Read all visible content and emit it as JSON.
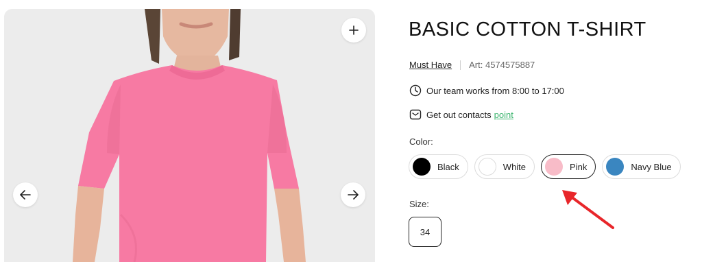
{
  "gallery": {
    "image_desc": "woman-wearing-pink-tshirt",
    "zoom_icon": "plus-icon",
    "prev_icon": "arrow-left-icon",
    "next_icon": "arrow-right-icon"
  },
  "product": {
    "title": "BASIC COTTON T-SHIRT",
    "brand": "Must Have",
    "article": "Art: 4574575887"
  },
  "info": {
    "hours": "Our team works from 8:00 to 17:00",
    "contacts_text": "Get out contacts",
    "contacts_link": "point",
    "hours_icon": "clock-icon",
    "contacts_icon": "message-icon"
  },
  "color": {
    "label": "Color:",
    "options": [
      {
        "name": "Black",
        "hex": "#000000",
        "selected": false
      },
      {
        "name": "White",
        "hex": "#ffffff",
        "selected": false
      },
      {
        "name": "Pink",
        "hex": "#f8bcc8",
        "selected": true
      },
      {
        "name": "Navy Blue",
        "hex": "#3a86c0",
        "selected": false
      }
    ]
  },
  "size": {
    "label": "Size:",
    "options": [
      "34"
    ]
  },
  "colors": {
    "accent_green": "#3cb46e",
    "annotation_red": "#e8262a",
    "shirt_pink": "#f77aa3"
  }
}
